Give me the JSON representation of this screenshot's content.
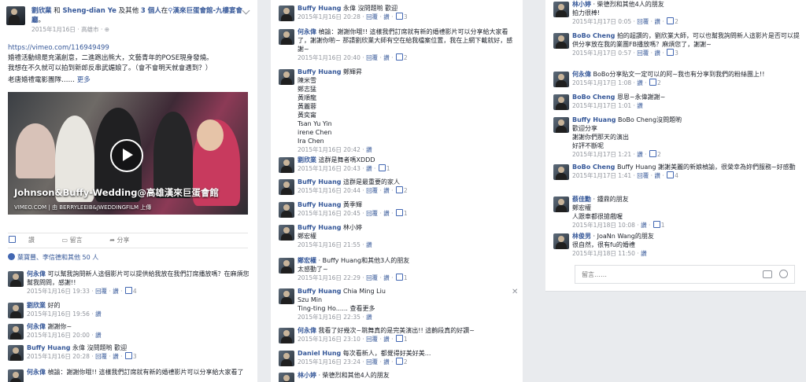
{
  "post": {
    "author": "劉欣業",
    "connector": "和",
    "with_name": "Sheng-dian Ye",
    "and_text": "及其他",
    "others_count": "3 個人",
    "at": "在",
    "place": "漢來巨蛋會館-九樓宴會廳",
    "period": "。",
    "date": "2015年1月16日",
    "location": "高雄市",
    "link": "https://vimeo.com/116949499",
    "text_lines": [
      "婚禮活動總是充滿創意，二進跑出熊大，文藝青年的POSE現身發燒。",
      "我想在不久就可以拍到新郎反串武媚娘了。（會不會明天就會遇到？）",
      "老唐婚禮電影團隊……"
    ],
    "more": "更多",
    "video": {
      "title": "Johnson&Buffy-Wedding@高雄漢來巨蛋會館",
      "domain": "VIMEO.COM",
      "source": "由 BERRYLEEIB&JWEDDINGFILM 上傳"
    },
    "actions": [
      "讚",
      "留言",
      "分享"
    ],
    "likes_text": "葉寶豐、李信德和其他 50 人"
  },
  "col1_comments": [
    {
      "name": "何永偉",
      "text": "可以幫我詢問新人這個影片可以提供給我放在我們訂席播放嗎？在麻煩您幫我問問，感謝!!",
      "time": "2015年1月16日 19:33",
      "reply": "回覆",
      "like": "讚",
      "count": "4"
    },
    {
      "name": "劉欣業",
      "text": "好的",
      "time": "2015年1月16日 19:56",
      "reply": "",
      "like": "讚",
      "count": ""
    },
    {
      "name": "何永偉",
      "text": "謝謝你~",
      "time": "2015年1月16日 20:00",
      "reply": "",
      "like": "讚",
      "count": ""
    },
    {
      "name": "Buffy Huang",
      "text": "永偉 沒問題喲 歡迎",
      "time": "2015年1月16日 20:28",
      "reply": "回覆",
      "like": "讚",
      "count": "3"
    },
    {
      "name": "何永偉",
      "text": "楨諭：謝謝你哦!! 這樣我們訂席就有新的婚禮影片可以分享給大家看了",
      "time": "",
      "reply": "",
      "like": "",
      "count": ""
    }
  ],
  "col2_comments": [
    {
      "name": "Buffy Huang",
      "text": "永偉 沒問題喲 歡迎",
      "time": "2015年1月16日 20:28",
      "reply": "回覆",
      "like": "讚",
      "count": "3"
    },
    {
      "name": "何永偉",
      "text": "楨諭：謝謝你哦!! 這樣我們訂席就有新的婚禮影片可以分享給大家看了，謝謝你喲~ 那請劉欣業大師有空在給我檔案位置，我在上網下載就好，感謝~",
      "time": "2015年1月16日 20:40",
      "reply": "回覆",
      "like": "讚",
      "count": "2"
    },
    {
      "name": "Buffy Huang",
      "text": "鄭輝昇\n陳米雪\n鄭志猛\n黃順龍\n黃麗蓉\n黃奕甯\nTsan Yu Yin\nirene Chen\nIra Chen",
      "time": "2015年1月16日 20:42",
      "reply": "",
      "like": "讚",
      "count": ""
    },
    {
      "name": "劉欣業",
      "text": "這群是舞者嗎XDDD",
      "time": "2015年1月16日 20:43",
      "reply": "讚",
      "like": "",
      "count": "1"
    },
    {
      "name": "Buffy Huang",
      "text": "這群是最重要的家人",
      "time": "2015年1月16日 20:44",
      "reply": "回覆",
      "like": "讚",
      "count": "2"
    },
    {
      "name": "Buffy Huang",
      "text": "黃季輝",
      "time": "2015年1月16日 20:45",
      "reply": "回覆",
      "like": "讚",
      "count": "1"
    },
    {
      "name": "Buffy Huang",
      "text": "林小婷\n鄭宏權",
      "time": "2015年1月16日 21:55",
      "reply": "",
      "like": "讚",
      "count": ""
    },
    {
      "name": "鄭宏權",
      "text": "· Buffy Huang和其他3人的朋友\n太感動了~",
      "time": "2015年1月16日 22:29",
      "reply": "回覆",
      "like": "讚",
      "count": "1"
    },
    {
      "name": "Buffy Huang",
      "text": "Chia Ming Liu\nSzu Min\nTing-ting Ho...... 查看更多",
      "time": "2015年1月16日 22:35",
      "reply": "",
      "like": "讚",
      "count": ""
    },
    {
      "name": "何永偉",
      "text": "我看了好幾次~跳舞真的是完美演出!! 這齣段真的好讚~",
      "time": "2015年1月16日 23:10",
      "reply": "回覆",
      "like": "讚",
      "count": "1"
    },
    {
      "name": "Daniel Hung",
      "text": "每次看新人，都覺得好美好美...",
      "time": "2015年1月16日 23:24",
      "reply": "回覆",
      "like": "讚",
      "count": "2"
    },
    {
      "name": "林小婷",
      "text": "· 柴德烈和其他4人的朋友",
      "time": "",
      "reply": "",
      "like": "",
      "count": ""
    }
  ],
  "col3_comments": [
    {
      "name": "林小婷",
      "text": "· 柴德烈和其他4人的朋友\n拍力很棒!",
      "time": "2015年1月17日 0:05",
      "reply": "回覆",
      "like": "讚",
      "count": "2"
    },
    {
      "name": "BoBo Cheng",
      "text": "拍的超讚的，劉欣業大師，可以也幫我詢問新人這影片是否可以提供分享放在我的業團FB播放嗎？麻煩您了，謝謝~",
      "time": "2015年1月17日 0:57",
      "reply": "回覆",
      "like": "讚",
      "count": "3"
    },
    {
      "name": "何永偉",
      "text": "BoBo分享貼文一定可以的阿~我也有分享到我們的粉絲團上!!",
      "time": "2015年1月17日 1:08",
      "reply": "讚",
      "like": "",
      "count": "2"
    },
    {
      "name": "BoBo Cheng",
      "text": "恩恩~永偉謝謝~",
      "time": "2015年1月17日 1:01",
      "reply": "讚",
      "like": "",
      "count": ""
    },
    {
      "name": "Buffy Huang",
      "text": "BoBo Cheng沒問題喲\n歡迎分享\n謝謝你們那天的演出\n好評不斷呢",
      "time": "2015年1月17日 1:21",
      "reply": "讚",
      "like": "",
      "count": "2"
    },
    {
      "name": "BoBo Cheng",
      "text": "Buffy Huang 謝謝美麗的新娘楨諭，很榮幸為妳們服務~好感動",
      "time": "2015年1月17日 1:41",
      "reply": "回覆",
      "like": "讚",
      "count": "4"
    },
    {
      "name": "蔡佳勳",
      "text": "· 鍾鼎的朋友\n鄭宏權\n人跟車都很搶戲喔",
      "time": "2015年1月18日 10:08",
      "reply": "讚",
      "like": "",
      "count": "1"
    },
    {
      "name": "林俊男",
      "text": "· JoaNn Wang的朋友\n很自然，很有fu的婚禮",
      "time": "2015年1月18日 11:50",
      "reply": "讚",
      "like": "",
      "count": ""
    }
  ],
  "reply_placeholder": "留言……",
  "colors": {
    "link": "#365899",
    "meta": "#90949c",
    "bg": "#e9ebee",
    "like": "#4267b2"
  }
}
